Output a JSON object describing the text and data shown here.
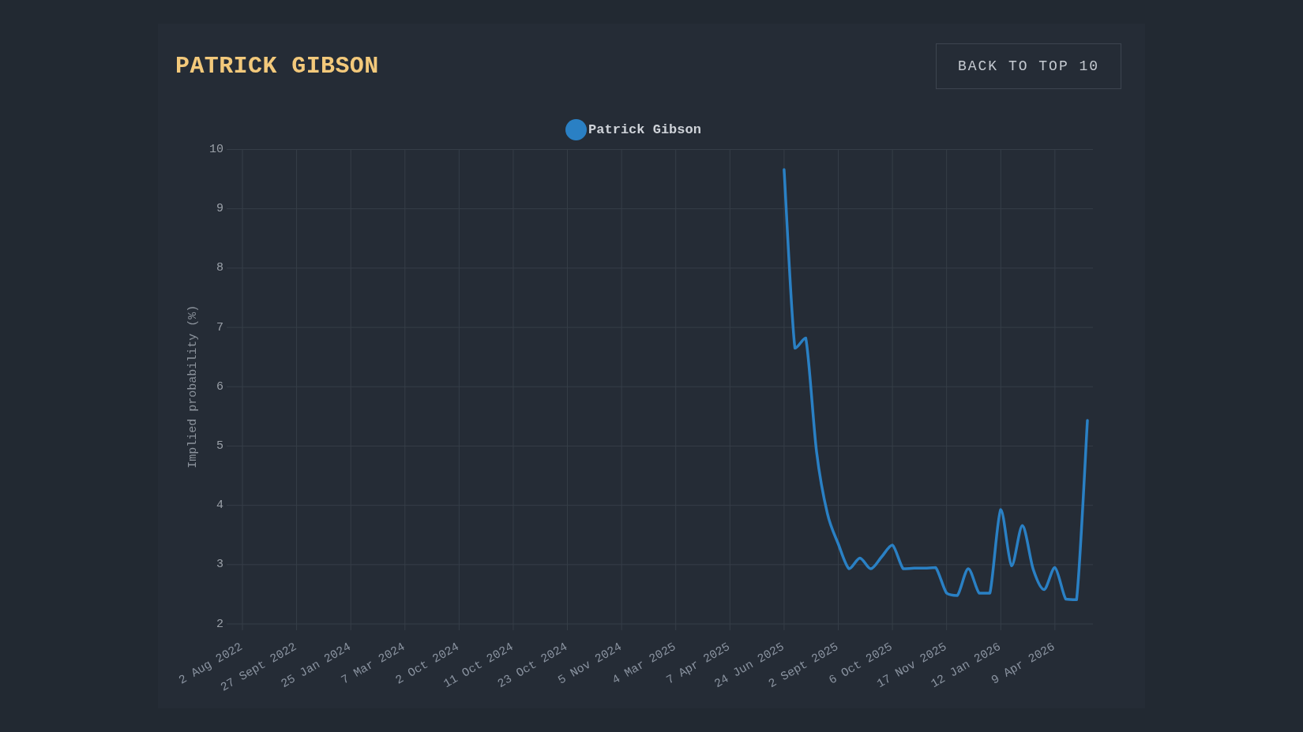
{
  "header": {
    "title": "PATRICK GIBSON",
    "button": "BACK TO TOP 10"
  },
  "chart": {
    "chart_data": {
      "type": "line",
      "grid": true,
      "ylabel": "Implied probability (%)",
      "ylim": [
        2,
        10
      ],
      "yticks": [
        2,
        3,
        4,
        5,
        6,
        7,
        8,
        9,
        10
      ],
      "categories": [
        "2 Aug 2022",
        null,
        null,
        null,
        null,
        "27 Sept 2022",
        null,
        null,
        null,
        null,
        "25 Jan 2024",
        null,
        null,
        null,
        null,
        "7 Mar 2024",
        null,
        null,
        null,
        null,
        "2 Oct 2024",
        null,
        null,
        null,
        null,
        "11 Oct 2024",
        null,
        null,
        null,
        null,
        "23 Oct 2024",
        null,
        null,
        null,
        null,
        "5 Nov 2024",
        null,
        null,
        null,
        null,
        "4 Mar 2025",
        null,
        null,
        null,
        null,
        "7 Apr 2025",
        null,
        null,
        null,
        null,
        "24 Jun 2025",
        null,
        null,
        null,
        null,
        "2 Sept 2025",
        null,
        null,
        null,
        null,
        "6 Oct 2025",
        null,
        null,
        null,
        null,
        "17 Nov 2025",
        null,
        null,
        null,
        null,
        "12 Jan 2026",
        null,
        null,
        null,
        null,
        "9 Apr 2026",
        null,
        null,
        null
      ],
      "series": [
        {
          "name": "Patrick Gibson",
          "color": "#2a80c4",
          "values": [
            null,
            null,
            null,
            null,
            null,
            null,
            null,
            null,
            null,
            null,
            null,
            null,
            null,
            null,
            null,
            null,
            null,
            null,
            null,
            null,
            null,
            null,
            null,
            null,
            null,
            null,
            null,
            null,
            null,
            null,
            null,
            null,
            null,
            null,
            null,
            null,
            null,
            null,
            null,
            null,
            null,
            null,
            null,
            null,
            null,
            null,
            null,
            null,
            null,
            null,
            9.66,
            6.65,
            6.82,
            4.9,
            3.86,
            3.35,
            2.93,
            3.11,
            2.93,
            3.13,
            3.33,
            2.93,
            2.94,
            2.94,
            2.95,
            2.52,
            2.48,
            2.93,
            2.52,
            2.52,
            3.93,
            2.98,
            3.66,
            2.92,
            2.58,
            2.95,
            2.42,
            2.41,
            5.43
          ]
        }
      ]
    }
  }
}
